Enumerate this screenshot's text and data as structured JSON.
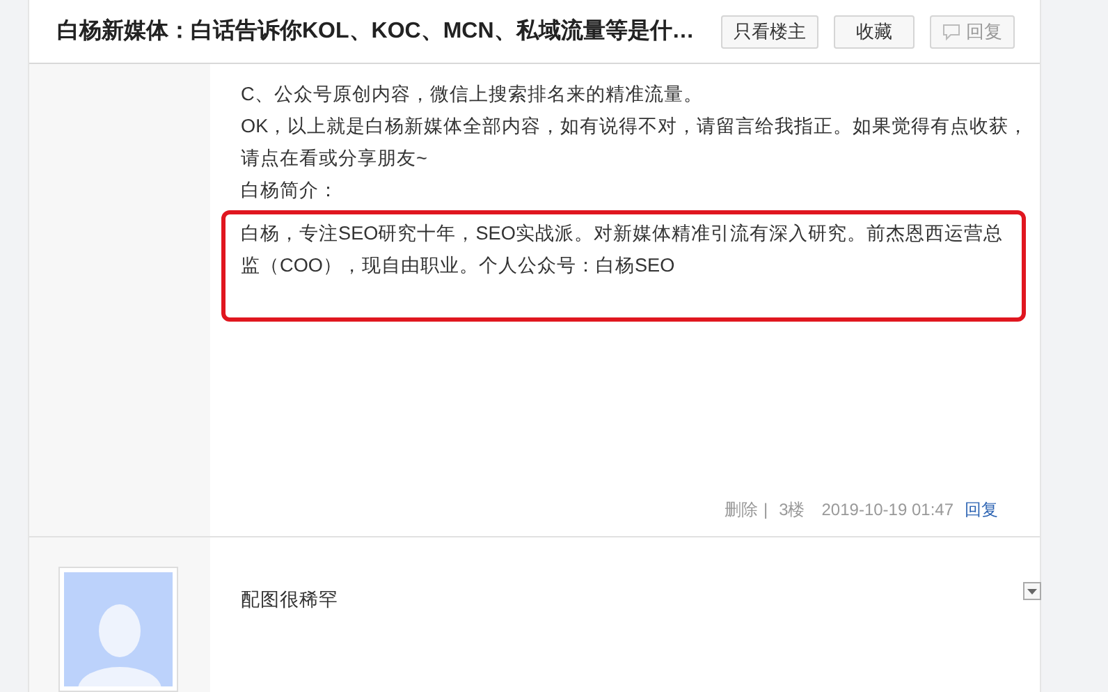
{
  "header": {
    "title": "白杨新媒体：白话告诉你KOL、KOC、MCN、私域流量等是什…",
    "buttons": [
      {
        "label": "只看楼主",
        "kind": "plain"
      },
      {
        "label": "收藏",
        "kind": "plain"
      },
      {
        "label": "回复",
        "kind": "reply"
      }
    ]
  },
  "posts": [
    {
      "paragraphs": [
        {
          "text": "C、公众号原创内容，微信上搜索排名来的精准流量。",
          "highlighted": false
        },
        {
          "text": "OK，以上就是白杨新媒体全部内容，如有说得不对，请留言给我指正。如果觉得有点收获，请点在看或分享朋友~",
          "highlighted": false
        },
        {
          "text": "白杨简介：",
          "highlighted": false
        },
        {
          "text": "白杨，专注SEO研究十年，SEO实战派。对新媒体精准引流有深入研究。前杰恩西运营总监（COO），现自由职业。个人公众号：白杨SEO",
          "highlighted": true
        }
      ],
      "footer": {
        "delete": "删除",
        "separator": "|",
        "floor": "3楼",
        "time": "2019-10-19 01:47",
        "reply": "回复"
      }
    },
    {
      "avatar": true,
      "paragraphs": [
        {
          "text": "配图很稀罕",
          "highlighted": false
        }
      ]
    }
  ]
}
